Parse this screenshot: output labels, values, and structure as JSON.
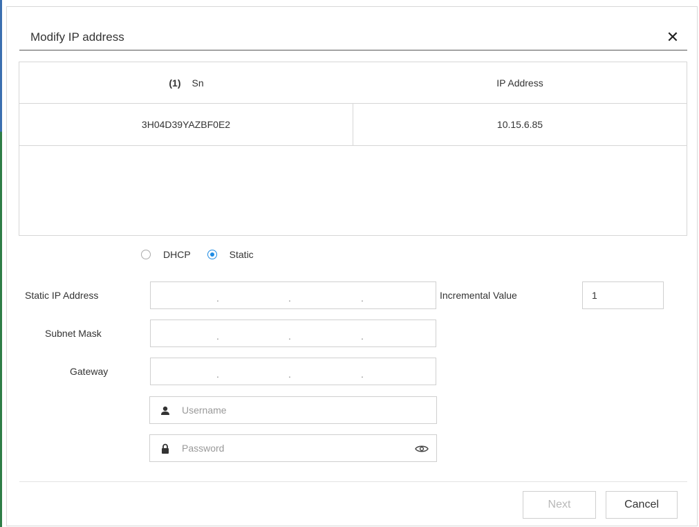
{
  "dialog": {
    "title": "Modify IP address",
    "close_icon": "close-icon"
  },
  "table": {
    "count": "(1)",
    "columns": [
      "Sn",
      "IP Address"
    ],
    "rows": [
      {
        "sn": "3H04D39YAZBF0E2",
        "ip": "10.15.6.85"
      }
    ]
  },
  "mode": {
    "options": [
      "DHCP",
      "Static"
    ],
    "selected": "Static"
  },
  "form": {
    "static_ip_label": "Static IP Address",
    "subnet_label": "Subnet Mask",
    "gateway_label": "Gateway",
    "incremental_label": "Incremental Value",
    "incremental_value": "1",
    "ip_separator": ".",
    "username_placeholder": "Username",
    "password_placeholder": "Password"
  },
  "buttons": {
    "next": "Next",
    "cancel": "Cancel"
  },
  "colors": {
    "accent": "#1e8be3",
    "disabled_text": "#b8b8b8"
  }
}
